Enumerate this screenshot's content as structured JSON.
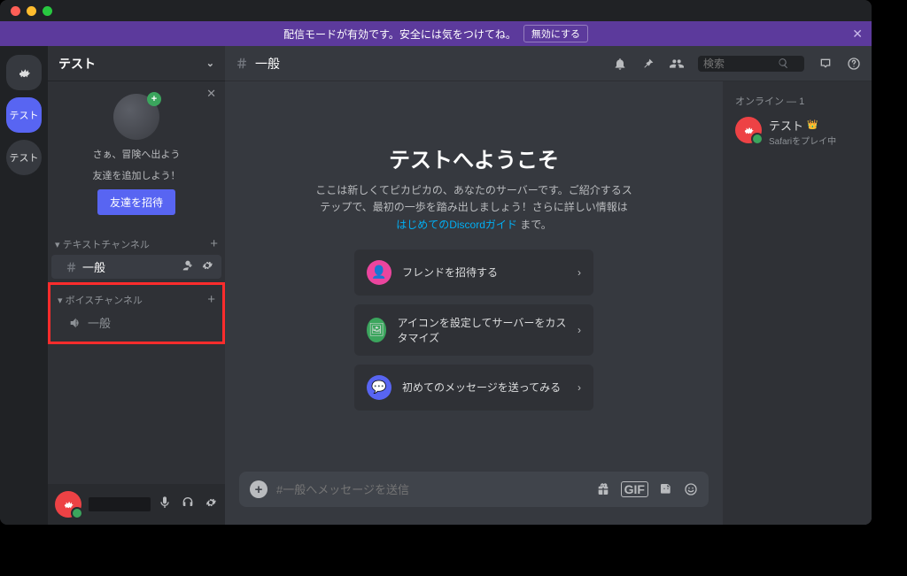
{
  "titlebar": {},
  "banner": {
    "text": "配信モードが有効です。安全には気をつけてね。",
    "button": "無効にする"
  },
  "guilds": {
    "active_label": "テスト",
    "other_label": "テスト"
  },
  "server": {
    "name": "テスト"
  },
  "invite_card": {
    "line1": "さぁ、冒険へ出よう",
    "line2": "友達を追加しよう！",
    "button": "友達を招待"
  },
  "categories": {
    "text": {
      "label": "テキストチャンネル",
      "channels": [
        {
          "name": "一般"
        }
      ]
    },
    "voice": {
      "label": "ボイスチャンネル",
      "channels": [
        {
          "name": "一般"
        }
      ]
    }
  },
  "channel_header": {
    "hash": "＃",
    "name": "一般",
    "search_placeholder": "検索"
  },
  "welcome": {
    "title": "テストへようこそ",
    "desc_prefix": "ここは新しくてピカピカの、あなたのサーバーです。ご紹介するステップで、最初の一歩を踏み出しましょう！さらに詳しい情報は ",
    "link": "はじめてのDiscordガイド",
    "desc_suffix": " まで。",
    "cards": [
      {
        "label": "フレンドを招待する"
      },
      {
        "label": "アイコンを設定してサーバーをカスタマイズ"
      },
      {
        "label": "初めてのメッセージを送ってみる"
      }
    ]
  },
  "composer": {
    "placeholder": "#一般へメッセージを送信",
    "gif_label": "GIF"
  },
  "members": {
    "group_label": "オンライン — 1",
    "items": [
      {
        "name": "テスト",
        "status": "Safariをプレイ中"
      }
    ]
  }
}
